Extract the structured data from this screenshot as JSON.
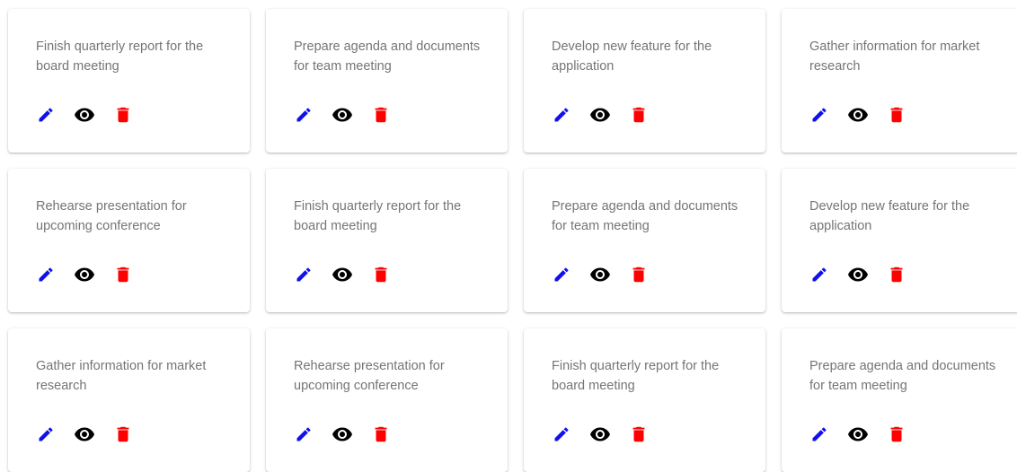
{
  "colors": {
    "edit": "#1010ee",
    "view": "#000000",
    "delete": "#ff0000",
    "text": "#757575"
  },
  "icons": {
    "edit": "pencil-icon",
    "view": "eye-icon",
    "delete": "trash-icon"
  },
  "cards": [
    {
      "text": "Finish quarterly report for the board meeting"
    },
    {
      "text": "Prepare agenda and documents for team meeting"
    },
    {
      "text": "Develop new feature for the application"
    },
    {
      "text": "Gather information for market research"
    },
    {
      "text": "Rehearse presentation for upcoming conference"
    },
    {
      "text": "Finish quarterly report for the board meeting"
    },
    {
      "text": "Prepare agenda and documents for team meeting"
    },
    {
      "text": "Develop new feature for the application"
    },
    {
      "text": "Gather information for market research"
    },
    {
      "text": "Rehearse presentation for upcoming conference"
    },
    {
      "text": "Finish quarterly report for the board meeting"
    },
    {
      "text": "Prepare agenda and documents for team meeting"
    }
  ]
}
